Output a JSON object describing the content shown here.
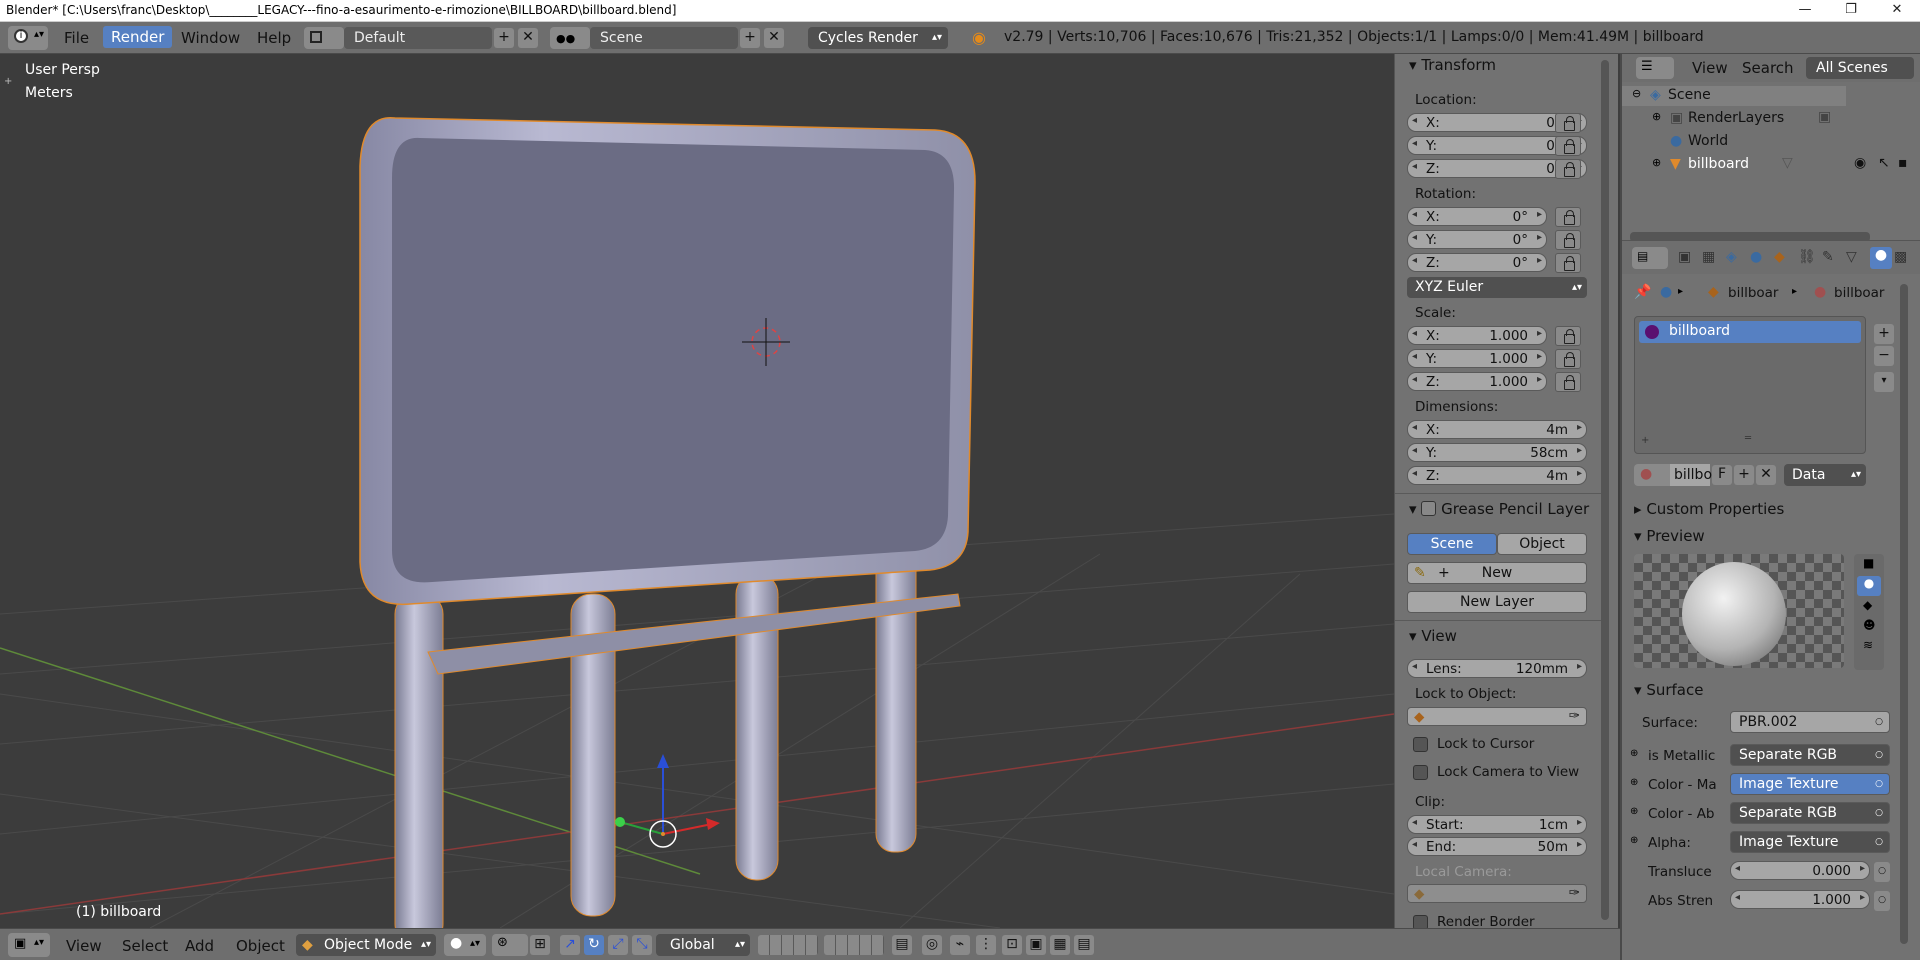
{
  "window": {
    "title": "Blender* [C:\\Users\\franc\\Desktop\\________LEGACY---fino-a-esaurimento-e-rimozione\\BILLBOARD\\billboard.blend]",
    "minimize": "—",
    "maximize": "❐",
    "close": "✕"
  },
  "header": {
    "menus": [
      "File",
      "Render",
      "Window",
      "Help"
    ],
    "layout": "Default",
    "scene": "Scene",
    "engine": "Cycles Render",
    "stats": "v2.79 | Verts:10,706 | Faces:10,676 | Tris:21,352 | Objects:1/1 | Lamps:0/0 | Mem:41.49M | billboard"
  },
  "viewport": {
    "view_name": "User Persp",
    "units": "Meters",
    "object_label": "(1) billboard"
  },
  "npanel": {
    "transform": {
      "title": "Transform",
      "location_label": "Location:",
      "location": [
        {
          "k": "X:",
          "v": "0m"
        },
        {
          "k": "Y:",
          "v": "0m"
        },
        {
          "k": "Z:",
          "v": "0m"
        }
      ],
      "rotation_label": "Rotation:",
      "rotation": [
        {
          "k": "X:",
          "v": "0°"
        },
        {
          "k": "Y:",
          "v": "0°"
        },
        {
          "k": "Z:",
          "v": "0°"
        }
      ],
      "rotation_mode": "XYZ Euler",
      "scale_label": "Scale:",
      "scale": [
        {
          "k": "X:",
          "v": "1.000"
        },
        {
          "k": "Y:",
          "v": "1.000"
        },
        {
          "k": "Z:",
          "v": "1.000"
        }
      ],
      "dimensions_label": "Dimensions:",
      "dimensions": [
        {
          "k": "X:",
          "v": "4m"
        },
        {
          "k": "Y:",
          "v": "58cm"
        },
        {
          "k": "Z:",
          "v": "4m"
        }
      ]
    },
    "grease_pencil": {
      "title": "Grease Pencil Layer",
      "scene_btn": "Scene",
      "object_btn": "Object",
      "new_btn": "New",
      "new_layer_btn": "New Layer"
    },
    "view": {
      "title": "View",
      "lens_label": "Lens:",
      "lens_value": "120mm",
      "lock_object_label": "Lock to Object:",
      "lock_cursor": "Lock to Cursor",
      "lock_camera": "Lock Camera to View",
      "clip_label": "Clip:",
      "clip_start_label": "Start:",
      "clip_start": "1cm",
      "clip_end_label": "End:",
      "clip_end": "50m",
      "local_camera_label": "Local Camera:",
      "render_border": "Render Border"
    }
  },
  "outliner": {
    "view": "View",
    "search": "Search",
    "filter": "All Scenes",
    "items": [
      "Scene",
      "RenderLayers",
      "World",
      "billboard"
    ]
  },
  "properties": {
    "breadcrumb": [
      "billboar",
      "billboar"
    ],
    "material_slot": "billboard",
    "material_name": "billbo",
    "fake_user": "F",
    "link": "Data",
    "custom_props": "Custom Properties",
    "preview": "Preview",
    "surface_title": "Surface",
    "surface_label": "Surface:",
    "surface_value": "PBR.002",
    "inputs": [
      {
        "label": "is Metallic",
        "value": "Separate RGB",
        "highlight": false
      },
      {
        "label": "Color - Ma",
        "value": "Image Texture",
        "highlight": true
      },
      {
        "label": "Color - Ab",
        "value": "Separate RGB",
        "highlight": false
      },
      {
        "label": "Alpha:",
        "value": "Image Texture",
        "highlight": false
      }
    ],
    "translucency_label": "Transluce",
    "translucency_value": "0.000",
    "abs_label": "Abs Stren",
    "abs_value": "1.000"
  },
  "bottombar": {
    "menus": [
      "View",
      "Select",
      "Add",
      "Object"
    ],
    "mode": "Object Mode",
    "orientation": "Global"
  },
  "colors": {
    "accent": "#5680c2",
    "billboard_face": "#6b6c84",
    "billboard_frame": "#a3a3bd",
    "selection_outline": "#e08a2c"
  }
}
